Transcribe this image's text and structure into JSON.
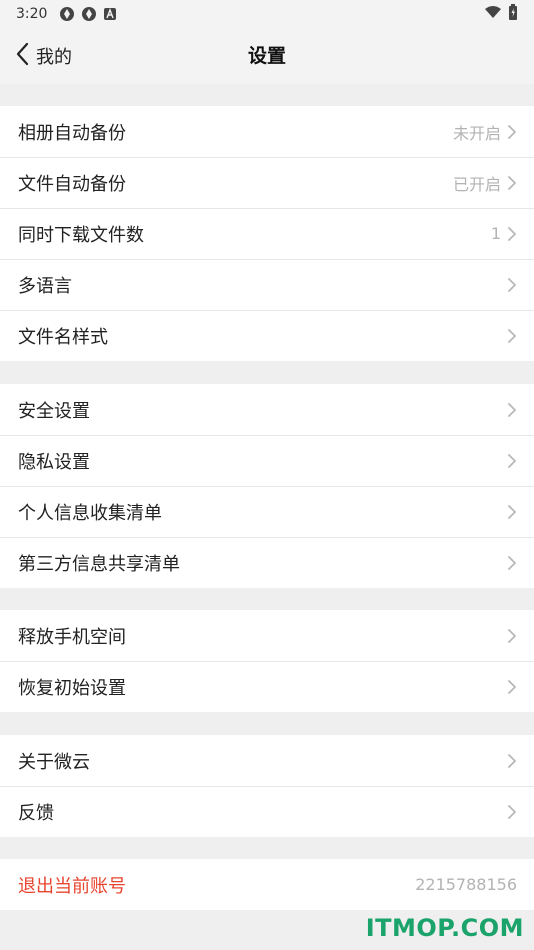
{
  "status_bar": {
    "time": "3:20",
    "icons": [
      "app-icon",
      "app-icon",
      "a-icon"
    ],
    "right_icons": [
      "wifi-icon",
      "battery-icon"
    ]
  },
  "nav": {
    "back_label": "我的",
    "title": "设置"
  },
  "groups": [
    {
      "items": [
        {
          "label": "相册自动备份",
          "value": "未开启"
        },
        {
          "label": "文件自动备份",
          "value": "已开启"
        },
        {
          "label": "同时下载文件数",
          "value": "1"
        },
        {
          "label": "多语言",
          "value": ""
        },
        {
          "label": "文件名样式",
          "value": ""
        }
      ]
    },
    {
      "items": [
        {
          "label": "安全设置",
          "value": ""
        },
        {
          "label": "隐私设置",
          "value": ""
        },
        {
          "label": "个人信息收集清单",
          "value": ""
        },
        {
          "label": "第三方信息共享清单",
          "value": ""
        }
      ]
    },
    {
      "items": [
        {
          "label": "释放手机空间",
          "value": ""
        },
        {
          "label": "恢复初始设置",
          "value": ""
        }
      ]
    },
    {
      "items": [
        {
          "label": "关于微云",
          "value": ""
        },
        {
          "label": "反馈",
          "value": ""
        }
      ]
    }
  ],
  "logout": {
    "label": "退出当前账号",
    "account": "2215788156"
  },
  "watermark": "ITMOP.COM",
  "colors": {
    "logout_text": "#e8442e",
    "watermark": "#1aa36a",
    "value_text": "#b3b3b3",
    "background": "#efefef"
  }
}
